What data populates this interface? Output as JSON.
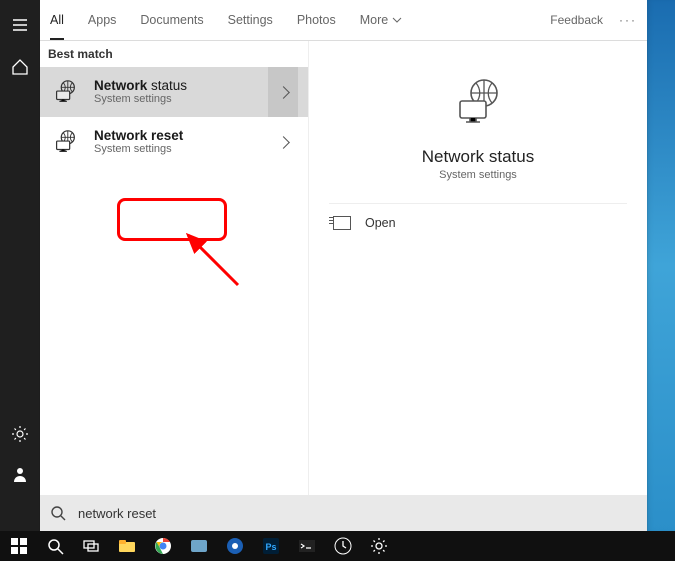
{
  "tabs": {
    "all": "All",
    "apps": "Apps",
    "documents": "Documents",
    "settings": "Settings",
    "photos": "Photos",
    "more": "More",
    "feedback": "Feedback"
  },
  "results": {
    "best_match_label": "Best match",
    "items": [
      {
        "title_prefix": "Network",
        "title_rest": " status",
        "subtitle": "System settings"
      },
      {
        "title_prefix": "Network reset",
        "title_rest": "",
        "subtitle": "System settings"
      }
    ]
  },
  "preview": {
    "title": "Network status",
    "subtitle": "System settings",
    "open_label": "Open"
  },
  "search": {
    "placeholder": "",
    "value": "network reset"
  },
  "rail": {
    "menu": "menu",
    "home": "home",
    "settings": "settings",
    "user": "user"
  },
  "taskbar_icons": [
    "start",
    "search",
    "task-view",
    "file-explorer",
    "chrome",
    "mail",
    "camera",
    "photoshop",
    "terminal",
    "clock",
    "settings-gear"
  ]
}
